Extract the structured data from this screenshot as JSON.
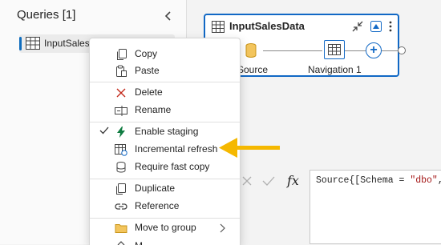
{
  "queries_pane": {
    "title": "Queries [1]",
    "items": [
      {
        "label": "InputSales"
      }
    ]
  },
  "query_card": {
    "title": "InputSalesData",
    "steps": [
      {
        "label": "Source",
        "icon": "database-icon"
      },
      {
        "label": "Navigation 1",
        "icon": "table-icon"
      }
    ]
  },
  "formula_bar": {
    "fx_label": "fx",
    "formula_prefix": "Source{[Schema = ",
    "formula_string": "\"dbo\"",
    "formula_suffix": ","
  },
  "context_menu": {
    "items": [
      {
        "label": "Copy",
        "icon": "copy-icon"
      },
      {
        "label": "Paste",
        "icon": "paste-icon"
      },
      {
        "label": "Delete",
        "icon": "delete-icon"
      },
      {
        "label": "Rename",
        "icon": "rename-icon"
      },
      {
        "label": "Enable staging",
        "icon": "lightning-icon",
        "checked": true
      },
      {
        "label": "Incremental refresh",
        "icon": "incremental-refresh-icon"
      },
      {
        "label": "Require fast copy",
        "icon": "fast-copy-icon"
      },
      {
        "label": "Duplicate",
        "icon": "duplicate-icon"
      },
      {
        "label": "Reference",
        "icon": "reference-icon"
      },
      {
        "label": "Move to group",
        "icon": "folder-icon",
        "has_submenu": true
      },
      {
        "label": "M",
        "icon": "more-icon"
      }
    ]
  },
  "colors": {
    "accent": "#1168c5",
    "arrow": "#f5b800",
    "staging_icon": "#107c41",
    "delete_icon": "#c42b1c",
    "folder": "#f3c55d"
  }
}
